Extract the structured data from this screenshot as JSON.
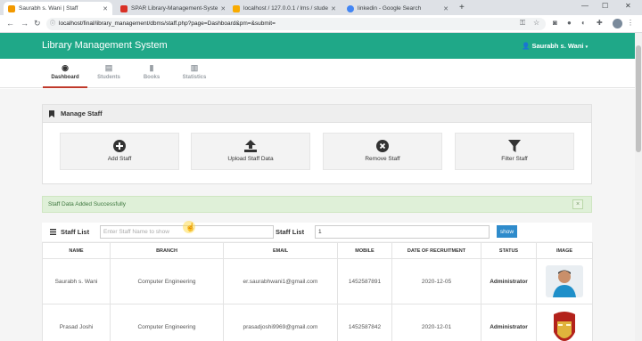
{
  "browser": {
    "tabs": [
      {
        "title": "Saurabh s. Wani | Staff",
        "favicon_color": "#f29900",
        "active": true
      },
      {
        "title": "SPAR Library-Management-Syste",
        "favicon_color": "#d93025",
        "active": false
      },
      {
        "title": "localhost / 127.0.0.1 / lms / stude",
        "favicon_color": "#f9ab00",
        "active": false
      },
      {
        "title": "linkedin - Google Search",
        "favicon_color": "#4285f4",
        "active": false
      }
    ],
    "url": "localhost/final/library_management/dbms/staff.php?page=Dashboard&pm=&submit="
  },
  "app": {
    "brand": "Library Management System",
    "user": "Saurabh s. Wani",
    "accent_color": "#1fa888"
  },
  "nav": {
    "tabs": [
      {
        "label": "Dashboard",
        "icon": "dashboard-icon",
        "active": true
      },
      {
        "label": "Students",
        "icon": "students-icon",
        "active": false
      },
      {
        "label": "Books",
        "icon": "book-icon",
        "active": false
      },
      {
        "label": "Statistics",
        "icon": "bar-chart-icon",
        "active": false
      }
    ]
  },
  "manage": {
    "title": "Manage Staff",
    "actions": [
      {
        "label": "Add Staff",
        "icon": "plus-circle-icon"
      },
      {
        "label": "Upload Staff Data",
        "icon": "upload-icon"
      },
      {
        "label": "Remove Staff",
        "icon": "remove-circle-icon"
      },
      {
        "label": "Filter Staff",
        "icon": "filter-icon"
      }
    ]
  },
  "alert": {
    "message": "Staff Data Added Successfully",
    "close": "×"
  },
  "staff_list": {
    "title": "Staff List",
    "search_placeholder": "Enter Staff Name to show",
    "second_label": "Staff List",
    "page_value": "1",
    "show_button": "show",
    "columns": [
      "NAME",
      "BRANCH",
      "EMAIL",
      "MOBILE",
      "DATE OF RECRUITMENT",
      "STATUS",
      "IMAGE"
    ],
    "rows": [
      {
        "name": "Saurabh s. Wani",
        "branch": "Computer Engineering",
        "email": "er.saurabhwani1@gmail.com",
        "mobile": "1452587891",
        "date": "2020-12-05",
        "status": "Administrator",
        "image": "person-photo"
      },
      {
        "name": "Prasad Joshi",
        "branch": "Computer Engineering",
        "email": "prasadjoshi9969@gmail.com",
        "mobile": "1452587842",
        "date": "2020-12-01",
        "status": "Administrator",
        "image": "ironman-photo"
      }
    ]
  }
}
